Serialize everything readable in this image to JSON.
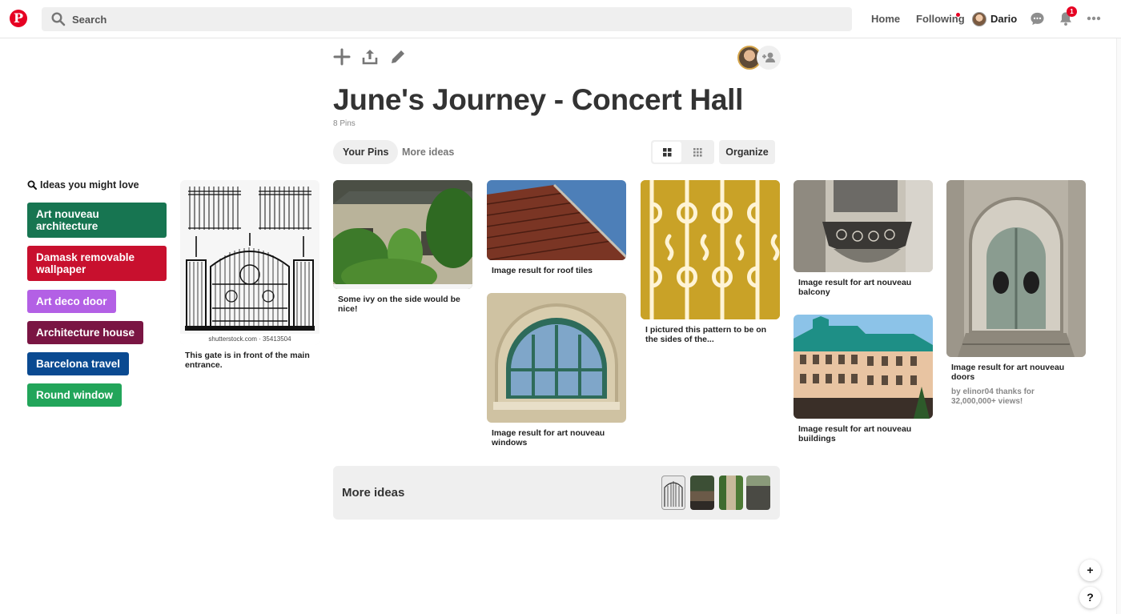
{
  "header": {
    "search_placeholder": "Search",
    "nav": {
      "home": "Home",
      "following": "Following",
      "user_name": "Dario"
    },
    "notification_count": "1"
  },
  "board": {
    "title": "June's Journey - Concert Hall",
    "pin_count": "8 Pins",
    "tabs": [
      "Your Pins",
      "More ideas"
    ],
    "organize_label": "Organize"
  },
  "sidebar": {
    "heading": "Ideas you might love",
    "items": [
      {
        "label": "Art nouveau architecture",
        "color": "#177551"
      },
      {
        "label": "Damask removable wallpaper",
        "color": "#c8102e"
      },
      {
        "label": "Art deco door",
        "color": "#b360e5"
      },
      {
        "label": "Architecture house",
        "color": "#7a1543"
      },
      {
        "label": "Barcelona travel",
        "color": "#0a4a91"
      },
      {
        "label": "Round window",
        "color": "#22a55a"
      }
    ]
  },
  "pins": [
    {
      "caption": "This gate is in front of the main entrance.",
      "source_text": "shutterstock.com · 35413504"
    },
    {
      "caption": "Some ivy on the side would be nice!"
    },
    {
      "caption": "Image result for roof tiles"
    },
    {
      "caption": "Image result for art nouveau windows"
    },
    {
      "caption": "I pictured this pattern to be on the sides of the..."
    },
    {
      "caption": "Image result for art nouveau balcony"
    },
    {
      "caption": "Image result for art nouveau buildings"
    },
    {
      "caption": "Image result for art nouveau doors",
      "attribution": "by elinor04 thanks for 32,000,000+ views!"
    }
  ],
  "more_ideas": {
    "label": "More ideas"
  },
  "floating": {
    "add": "+",
    "help": "?"
  }
}
